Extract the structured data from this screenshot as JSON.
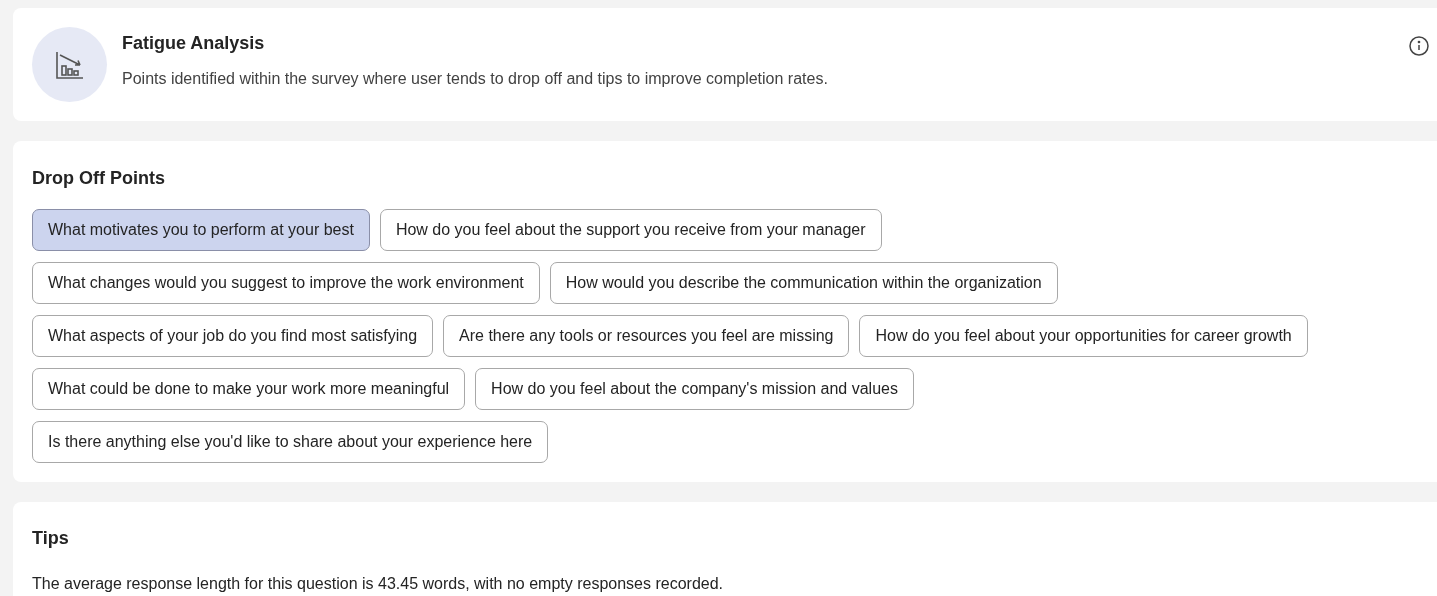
{
  "header": {
    "title": "Fatigue Analysis",
    "description": "Points identified within the survey where user tends to drop off and tips to improve completion rates."
  },
  "drop_off": {
    "title": "Drop Off Points",
    "rows": [
      [
        {
          "label": "What motivates you to perform at your best",
          "selected": true
        },
        {
          "label": "How do you feel about the support you receive from your manager",
          "selected": false
        }
      ],
      [
        {
          "label": "What changes would you suggest to improve the work environment",
          "selected": false
        },
        {
          "label": "How would you describe the communication within the organization",
          "selected": false
        }
      ],
      [
        {
          "label": "What aspects of your job do you find most satisfying",
          "selected": false
        },
        {
          "label": "Are there any tools or resources you feel are missing",
          "selected": false
        },
        {
          "label": "How do you feel about your opportunities for career growth",
          "selected": false
        }
      ],
      [
        {
          "label": "What could be done to make your work more meaningful",
          "selected": false
        },
        {
          "label": "How do you feel about the company's mission and values",
          "selected": false
        }
      ],
      [
        {
          "label": "Is there anything else you'd like to share about your experience here",
          "selected": false
        }
      ]
    ]
  },
  "tips": {
    "title": "Tips",
    "text": "The average response length for this question is 43.45 words, with no empty responses recorded."
  }
}
